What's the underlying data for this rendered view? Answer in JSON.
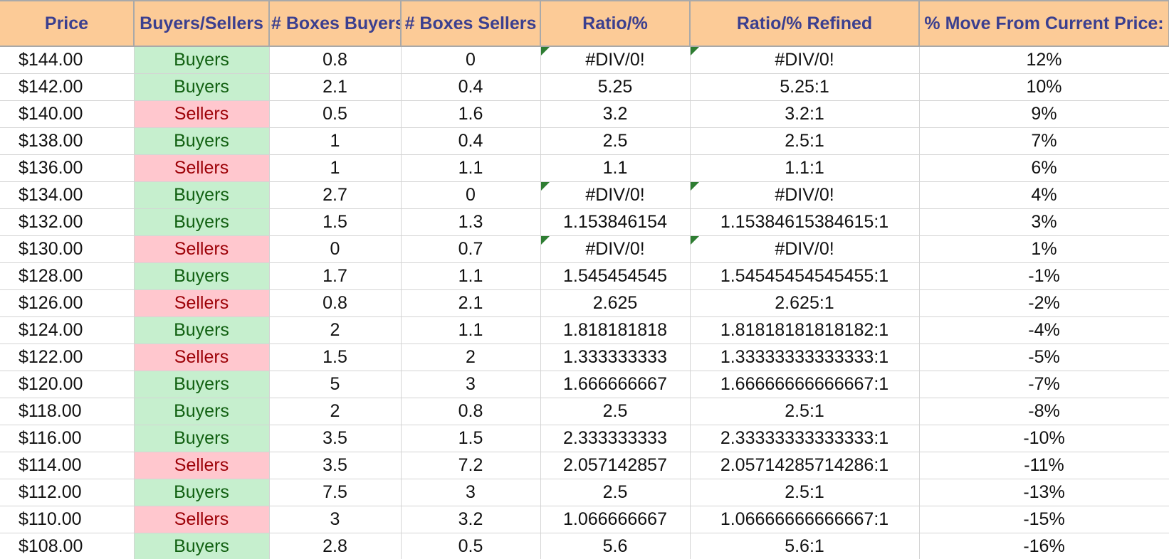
{
  "headers": [
    "Price",
    "Buyers/Sellers",
    "# Boxes Buyers",
    "# Boxes Sellers",
    "Ratio/%",
    "Ratio/% Refined",
    "% Move From Current Price:"
  ],
  "rows": [
    {
      "price": "$144.00",
      "side": "Buyers",
      "buyers": "0.8",
      "sellers": "0",
      "ratio": "#DIV/0!",
      "refined": "#DIV/0!",
      "move": "12%",
      "error": true
    },
    {
      "price": "$142.00",
      "side": "Buyers",
      "buyers": "2.1",
      "sellers": "0.4",
      "ratio": "5.25",
      "refined": "5.25:1",
      "move": "10%",
      "error": false
    },
    {
      "price": "$140.00",
      "side": "Sellers",
      "buyers": "0.5",
      "sellers": "1.6",
      "ratio": "3.2",
      "refined": "3.2:1",
      "move": "9%",
      "error": false
    },
    {
      "price": "$138.00",
      "side": "Buyers",
      "buyers": "1",
      "sellers": "0.4",
      "ratio": "2.5",
      "refined": "2.5:1",
      "move": "7%",
      "error": false
    },
    {
      "price": "$136.00",
      "side": "Sellers",
      "buyers": "1",
      "sellers": "1.1",
      "ratio": "1.1",
      "refined": "1.1:1",
      "move": "6%",
      "error": false
    },
    {
      "price": "$134.00",
      "side": "Buyers",
      "buyers": "2.7",
      "sellers": "0",
      "ratio": "#DIV/0!",
      "refined": "#DIV/0!",
      "move": "4%",
      "error": true
    },
    {
      "price": "$132.00",
      "side": "Buyers",
      "buyers": "1.5",
      "sellers": "1.3",
      "ratio": "1.153846154",
      "refined": "1.15384615384615:1",
      "move": "3%",
      "error": false
    },
    {
      "price": "$130.00",
      "side": "Sellers",
      "buyers": "0",
      "sellers": "0.7",
      "ratio": "#DIV/0!",
      "refined": "#DIV/0!",
      "move": "1%",
      "error": true
    },
    {
      "price": "$128.00",
      "side": "Buyers",
      "buyers": "1.7",
      "sellers": "1.1",
      "ratio": "1.545454545",
      "refined": "1.54545454545455:1",
      "move": "-1%",
      "error": false
    },
    {
      "price": "$126.00",
      "side": "Sellers",
      "buyers": "0.8",
      "sellers": "2.1",
      "ratio": "2.625",
      "refined": "2.625:1",
      "move": "-2%",
      "error": false
    },
    {
      "price": "$124.00",
      "side": "Buyers",
      "buyers": "2",
      "sellers": "1.1",
      "ratio": "1.818181818",
      "refined": "1.81818181818182:1",
      "move": "-4%",
      "error": false
    },
    {
      "price": "$122.00",
      "side": "Sellers",
      "buyers": "1.5",
      "sellers": "2",
      "ratio": "1.333333333",
      "refined": "1.33333333333333:1",
      "move": "-5%",
      "error": false
    },
    {
      "price": "$120.00",
      "side": "Buyers",
      "buyers": "5",
      "sellers": "3",
      "ratio": "1.666666667",
      "refined": "1.66666666666667:1",
      "move": "-7%",
      "error": false
    },
    {
      "price": "$118.00",
      "side": "Buyers",
      "buyers": "2",
      "sellers": "0.8",
      "ratio": "2.5",
      "refined": "2.5:1",
      "move": "-8%",
      "error": false
    },
    {
      "price": "$116.00",
      "side": "Buyers",
      "buyers": "3.5",
      "sellers": "1.5",
      "ratio": "2.333333333",
      "refined": "2.33333333333333:1",
      "move": "-10%",
      "error": false
    },
    {
      "price": "$114.00",
      "side": "Sellers",
      "buyers": "3.5",
      "sellers": "7.2",
      "ratio": "2.057142857",
      "refined": "2.05714285714286:1",
      "move": "-11%",
      "error": false
    },
    {
      "price": "$112.00",
      "side": "Buyers",
      "buyers": "7.5",
      "sellers": "3",
      "ratio": "2.5",
      "refined": "2.5:1",
      "move": "-13%",
      "error": false
    },
    {
      "price": "$110.00",
      "side": "Sellers",
      "buyers": "3",
      "sellers": "3.2",
      "ratio": "1.066666667",
      "refined": "1.06666666666667:1",
      "move": "-15%",
      "error": false
    },
    {
      "price": "$108.00",
      "side": "Buyers",
      "buyers": "2.8",
      "sellers": "0.5",
      "ratio": "5.6",
      "refined": "5.6:1",
      "move": "-16%",
      "error": false
    }
  ],
  "colors": {
    "header_bg": "#fccb97",
    "header_text": "#3b3f8f",
    "buyers_bg": "#c6efce",
    "buyers_text": "#116011",
    "sellers_bg": "#ffc7ce",
    "sellers_text": "#9c0006",
    "error_indicator": "#2e7d32"
  }
}
